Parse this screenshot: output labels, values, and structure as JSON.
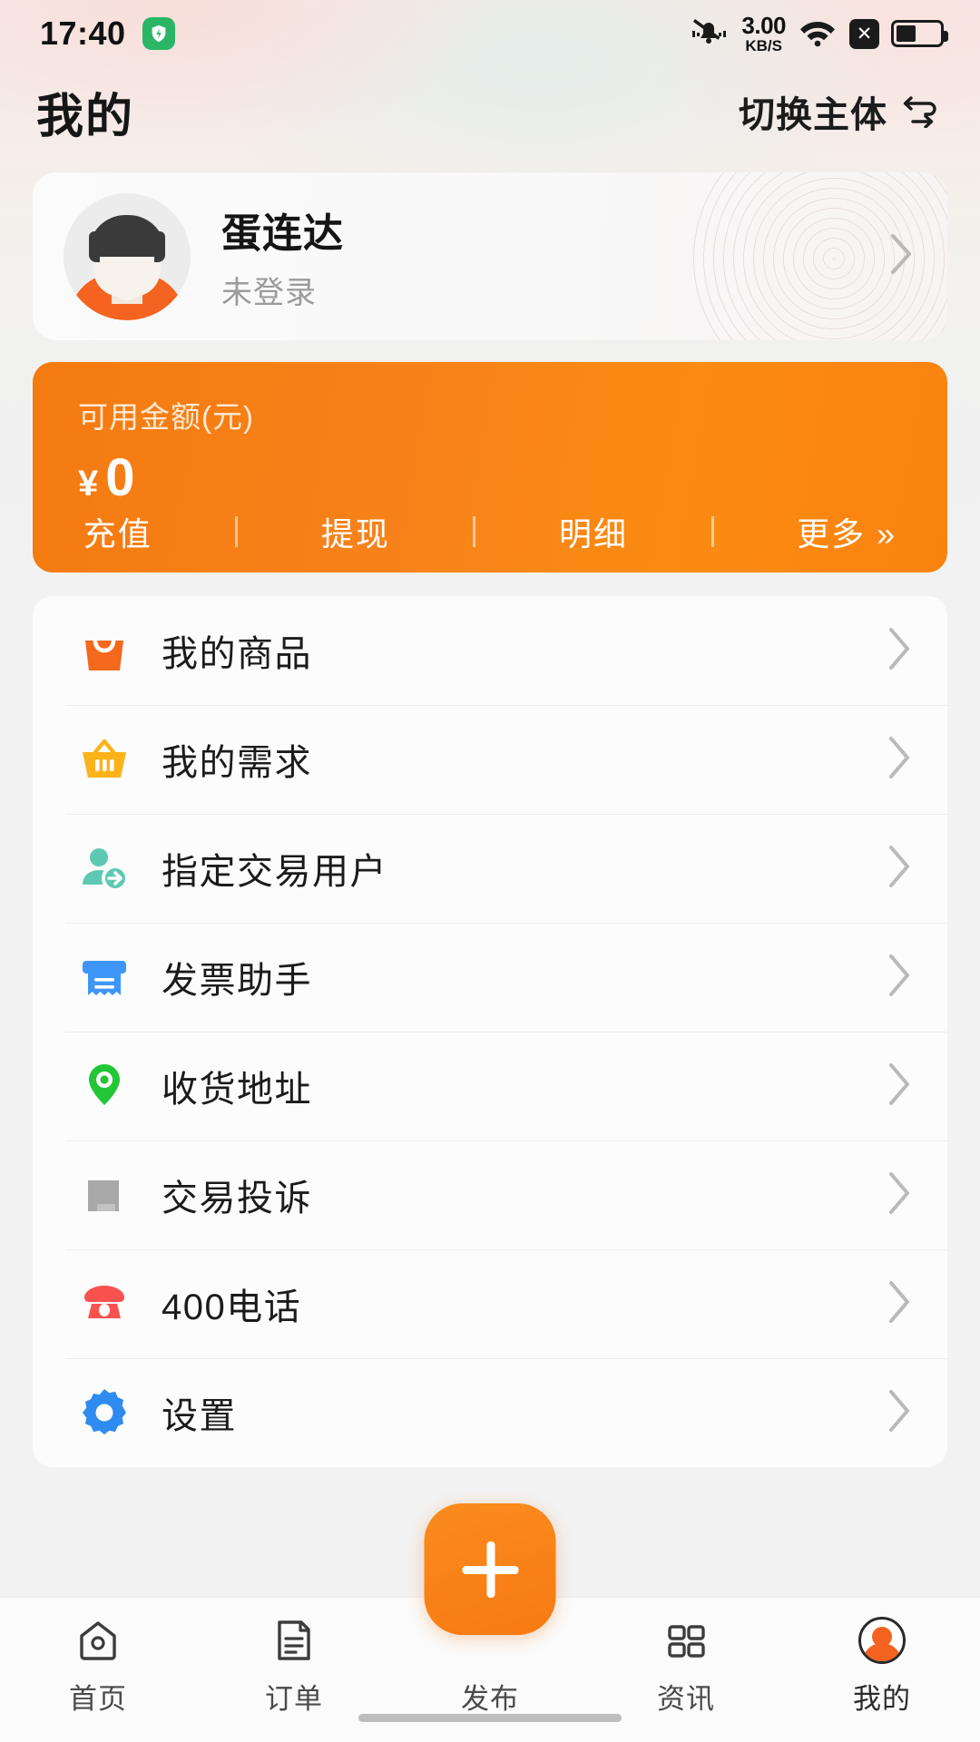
{
  "status_bar": {
    "time": "17:40",
    "shield_icon": "shield-check-icon",
    "mute_icon": "bell-muted-icon",
    "net_speed_value": "3.00",
    "net_speed_unit": "KB/S",
    "wifi_icon": "wifi-icon",
    "x_icon": "close-box-icon",
    "battery_icon": "battery-icon"
  },
  "header": {
    "title": "我的",
    "switch_entity_label": "切换主体",
    "switch_entity_icon": "swap-icon"
  },
  "profile": {
    "name": "蛋连达",
    "status": "未登录",
    "avatar_icon": "avatar",
    "chevron_icon": "chevron-right-icon"
  },
  "balance": {
    "label": "可用金额(元)",
    "currency_symbol": "¥",
    "amount": "0",
    "accent_color": "#f7821a",
    "actions": [
      {
        "label": "充值"
      },
      {
        "label": "提现"
      },
      {
        "label": "明细"
      },
      {
        "label": "更多 »"
      }
    ]
  },
  "menu": {
    "items": [
      {
        "label": "我的商品",
        "icon": "shopping-bag-icon",
        "color": "#f4691b"
      },
      {
        "label": "我的需求",
        "icon": "basket-icon",
        "color": "#fbb319"
      },
      {
        "label": "指定交易用户",
        "icon": "user-add-icon",
        "color": "#5ec9b2"
      },
      {
        "label": "发票助手",
        "icon": "invoice-icon",
        "color": "#3d96f7"
      },
      {
        "label": "收货地址",
        "icon": "location-pin-icon",
        "color": "#23c637"
      },
      {
        "label": "交易投诉",
        "icon": "complaint-doc-icon",
        "color": "#a8a8a8"
      },
      {
        "label": "400电话",
        "icon": "telephone-icon",
        "color": "#f8524f"
      },
      {
        "label": "设置",
        "icon": "gear-icon",
        "color": "#2e8bf0"
      }
    ],
    "chevron_icon": "chevron-right-icon"
  },
  "tabbar": {
    "items": [
      {
        "label": "首页",
        "icon": "home-icon",
        "active": false
      },
      {
        "label": "订单",
        "icon": "order-icon",
        "active": false
      },
      {
        "label": "发布",
        "icon": "plus-icon",
        "active": false
      },
      {
        "label": "资讯",
        "icon": "grid-icon",
        "active": false
      },
      {
        "label": "我的",
        "icon": "profile-icon",
        "active": true
      }
    ],
    "fab_icon": "plus-icon"
  }
}
